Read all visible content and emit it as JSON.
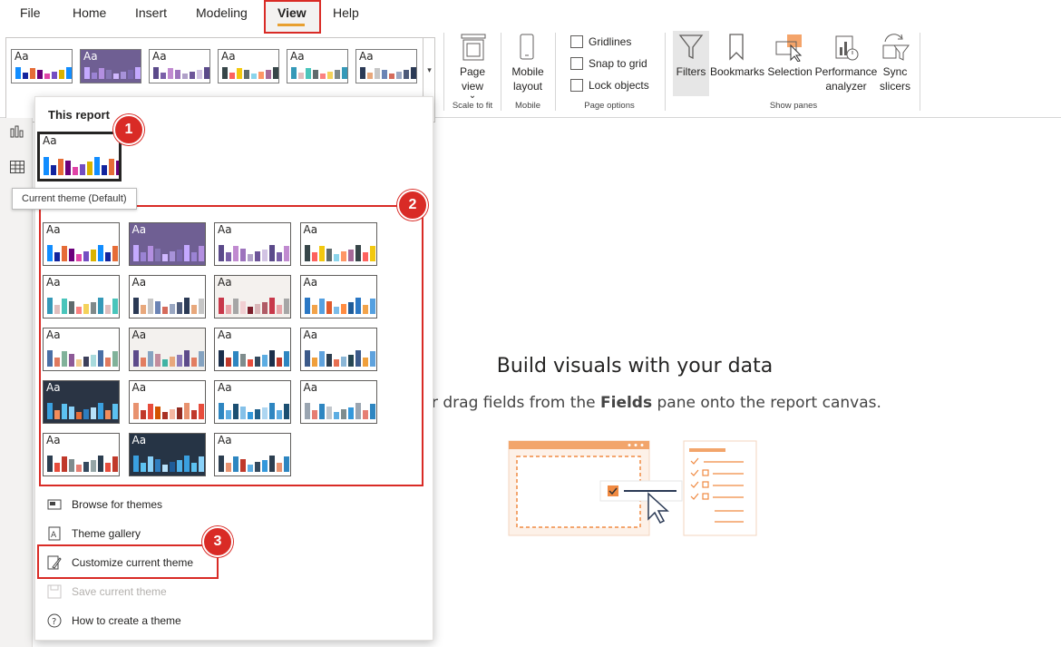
{
  "menu": {
    "items": [
      "File",
      "Home",
      "Insert",
      "Modeling",
      "View",
      "Help"
    ],
    "active": "View"
  },
  "ribbon": {
    "page_view_label": "Page view",
    "page_view_chevron": "⌄",
    "mobile_layout_label": "Mobile layout",
    "groups": {
      "scale": "Scale to fit",
      "mobile": "Mobile",
      "page_options": "Page options",
      "show_panes": "Show panes"
    },
    "page_options": [
      "Gridlines",
      "Snap to grid",
      "Lock objects"
    ],
    "panes": [
      "Filters",
      "Bookmarks",
      "Selection",
      "Performance analyzer",
      "Sync slicers"
    ]
  },
  "dropdown": {
    "section_title": "This report",
    "tooltip": "Current theme (Default)",
    "aa": "Aa",
    "badges": [
      "1",
      "2",
      "3"
    ],
    "actions": [
      {
        "label": "Browse for themes",
        "icon": "folder-icon",
        "enabled": true
      },
      {
        "label": "Theme gallery",
        "icon": "gallery-icon",
        "enabled": true
      },
      {
        "label": "Customize current theme",
        "icon": "brush-icon",
        "enabled": true
      },
      {
        "label": "Save current theme",
        "icon": "save-icon",
        "enabled": false
      },
      {
        "label": "How to create a theme",
        "icon": "help-icon",
        "enabled": true
      }
    ]
  },
  "themes": [
    {
      "bg": "#ffffff",
      "colors": [
        "#118dff",
        "#12239e",
        "#e66c37",
        "#6b007b",
        "#e044a7",
        "#744ec2",
        "#d9b300"
      ]
    },
    {
      "bg": "#6f5f93",
      "colors": [
        "#c4a9ff",
        "#9b83d4",
        "#b38fe0",
        "#8676b5",
        "#d0b8ff",
        "#a792d9",
        "#7c6ab0"
      ]
    },
    {
      "bg": "#ffffff",
      "colors": [
        "#5b4a8a",
        "#7a5fa8",
        "#c08ad0",
        "#9d73bd",
        "#b0a0c8",
        "#6d5499",
        "#d2c3e3"
      ]
    },
    {
      "bg": "#ffffff",
      "colors": [
        "#374649",
        "#fd625e",
        "#f2c80f",
        "#5f6b6d",
        "#8ad4eb",
        "#fe9666",
        "#a66999"
      ]
    },
    {
      "bg": "#ffffff",
      "colors": [
        "#3599b8",
        "#dfbfbf",
        "#4ac5bb",
        "#5f6b6d",
        "#fb8281",
        "#f4d25a",
        "#7f898a"
      ]
    },
    {
      "bg": "#ffffff",
      "colors": [
        "#2b3a55",
        "#e8a87c",
        "#c6c6c6",
        "#6b84b5",
        "#d56b5b",
        "#9aa7c2",
        "#4d5b7a"
      ]
    },
    {
      "bg": "#f4f1ee",
      "colors": [
        "#c8384a",
        "#e7a4a8",
        "#a6a6a6",
        "#f1cfd2",
        "#7d1f2c",
        "#d9b6b8",
        "#b05b66"
      ]
    },
    {
      "bg": "#ffffff",
      "colors": [
        "#2b78c5",
        "#f2a34a",
        "#55a0e0",
        "#e05a2b",
        "#7cbce8",
        "#ff8c42",
        "#1f5c99"
      ]
    },
    {
      "bg": "#ffffff",
      "colors": [
        "#4a6fa5",
        "#e07a5f",
        "#81b29a",
        "#8d5a97",
        "#f2cc8f",
        "#3d405b",
        "#a8dadc"
      ]
    },
    {
      "bg": "#f3f1ee",
      "colors": [
        "#5d4b8a",
        "#e27d60",
        "#85a3c1",
        "#c38d9e",
        "#41b3a3",
        "#e8a87c",
        "#8b7ab8"
      ]
    },
    {
      "bg": "#ffffff",
      "colors": [
        "#1c2f4b",
        "#c0392b",
        "#2e86c1",
        "#7f8c8d",
        "#e74c3c",
        "#34495e",
        "#5dade2"
      ]
    },
    {
      "bg": "#ffffff",
      "colors": [
        "#3c5a8a",
        "#f0a03c",
        "#5fa2dd",
        "#2c3e50",
        "#e76f51",
        "#8ab6d6",
        "#264653"
      ]
    },
    {
      "bg": "#2a3444",
      "colors": [
        "#3aa0e0",
        "#f28c5a",
        "#5cc1f0",
        "#8ad1f8",
        "#e66c37",
        "#2e7dbf",
        "#b7e1fa"
      ]
    },
    {
      "bg": "#ffffff",
      "colors": [
        "#e8926f",
        "#c0392b",
        "#e74c3c",
        "#d35400",
        "#a93226",
        "#f5b7a1",
        "#922b21"
      ]
    },
    {
      "bg": "#ffffff",
      "colors": [
        "#2e86c1",
        "#5dade2",
        "#1b4f72",
        "#85c1e9",
        "#3498db",
        "#21618c",
        "#aed6f1"
      ]
    },
    {
      "bg": "#ffffff",
      "colors": [
        "#9aa5b1",
        "#e67e73",
        "#2e86c1",
        "#c0c6cc",
        "#5dade2",
        "#7f8c8d",
        "#3498db"
      ]
    },
    {
      "bg": "#ffffff",
      "colors": [
        "#2c3e50",
        "#e74c3c",
        "#c0392b",
        "#7f8c8d",
        "#e67e73",
        "#34495e",
        "#95a5a6"
      ]
    },
    {
      "bg": "#263445",
      "colors": [
        "#3aa0e0",
        "#5cc1f0",
        "#8ad1f8",
        "#2e7dbf",
        "#b7e1fa",
        "#1f5c99",
        "#4fb2ea"
      ]
    },
    {
      "bg": "#ffffff",
      "colors": [
        "#2c3e50",
        "#e8926f",
        "#2e86c1",
        "#c0392b",
        "#5dade2",
        "#34495e",
        "#3498db"
      ]
    }
  ],
  "current_theme": {
    "bg": "#ffffff",
    "colors": [
      "#118dff",
      "#12239e",
      "#e66c37",
      "#6b007b",
      "#e044a7",
      "#744ec2",
      "#d9b300"
    ]
  },
  "canvas": {
    "title": "Build visuals with your data",
    "subtitle_prefix": "r drag fields from the ",
    "subtitle_bold": "Fields",
    "subtitle_suffix": " pane onto the report canvas."
  },
  "accent": "#d92b26"
}
